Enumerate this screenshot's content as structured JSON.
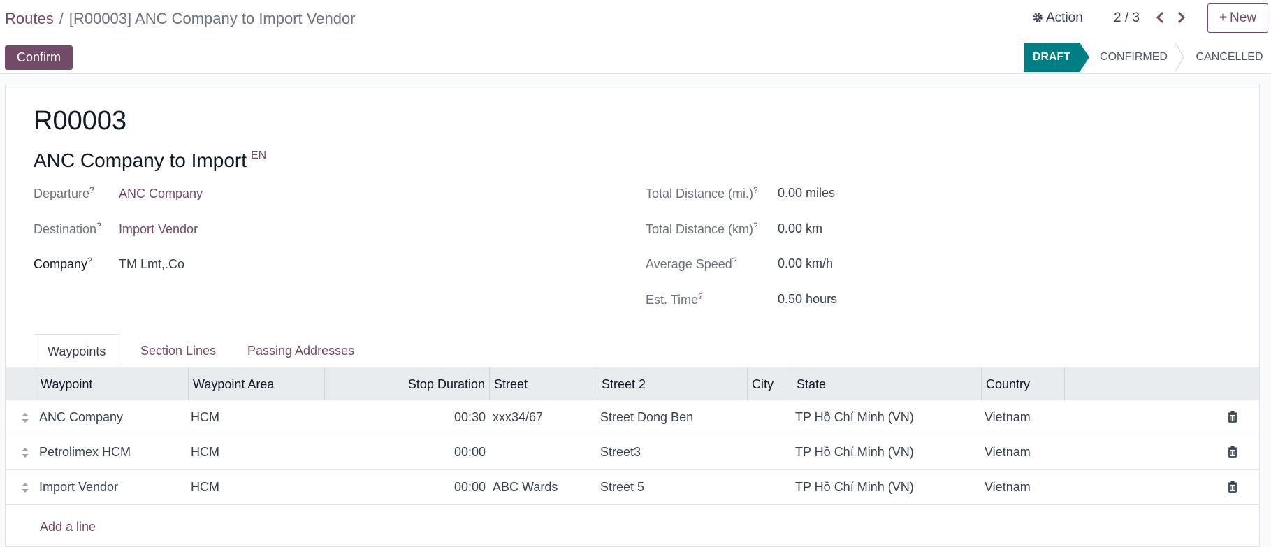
{
  "breadcrumb": {
    "root": "Routes",
    "separator": "/",
    "current": "[R00003] ANC Company to Import Vendor"
  },
  "header": {
    "action_label": "Action",
    "pager": "2 / 3",
    "new_label": "New"
  },
  "control": {
    "confirm_label": "Confirm"
  },
  "stages": {
    "draft": "DRAFT",
    "confirmed": "CONFIRMED",
    "cancelled": "CANCELLED",
    "active": "DRAFT"
  },
  "record": {
    "ref": "R00003",
    "name": "ANC Company to Import",
    "lang": "EN"
  },
  "fields": {
    "departure": {
      "label": "Departure",
      "help": "?",
      "value": "ANC Company"
    },
    "destination": {
      "label": "Destination",
      "help": "?",
      "value": "Import Vendor"
    },
    "company": {
      "label": "Company",
      "help": "?",
      "value": "TM Lmt,.Co"
    },
    "distance_mi": {
      "label": "Total Distance (mi.)",
      "help": "?",
      "value": "0.00 miles"
    },
    "distance_km": {
      "label": "Total Distance (km)",
      "help": "?",
      "value": "0.00 km"
    },
    "avg_speed": {
      "label": "Average Speed",
      "help": "?",
      "value": "0.00 km/h"
    },
    "est_time": {
      "label": "Est. Time",
      "help": "?",
      "value": "0.50 hours"
    }
  },
  "tabs": [
    "Waypoints",
    "Section Lines",
    "Passing Addresses"
  ],
  "table": {
    "columns": [
      "Waypoint",
      "Waypoint Area",
      "Stop Duration",
      "Street",
      "Street 2",
      "City",
      "State",
      "Country"
    ],
    "rows": [
      {
        "waypoint": "ANC Company",
        "area": "HCM",
        "duration": "00:30",
        "street": "xxx34/67",
        "street2": "Street Dong Ben",
        "city": "",
        "state": "TP Hồ Chí Minh (VN)",
        "country": "Vietnam"
      },
      {
        "waypoint": "Petrolimex HCM",
        "area": "HCM",
        "duration": "00:00",
        "street": "",
        "street2": "Street3",
        "city": "",
        "state": "TP Hồ Chí Minh (VN)",
        "country": "Vietnam"
      },
      {
        "waypoint": "Import Vendor",
        "area": "HCM",
        "duration": "00:00",
        "street": "ABC Wards",
        "street2": "Street 5",
        "city": "",
        "state": "TP Hồ Chí Minh (VN)",
        "country": "Vietnam"
      }
    ],
    "add_line": "Add a line"
  },
  "icons": {
    "action": "gear-icon",
    "prev": "chevron-left-icon",
    "next": "chevron-right-icon",
    "new": "plus-icon",
    "row_handle": "drag-handle-icon",
    "row_delete": "trash-icon"
  },
  "colors": {
    "brand": "#714b67",
    "stage_active": "#017e84"
  }
}
